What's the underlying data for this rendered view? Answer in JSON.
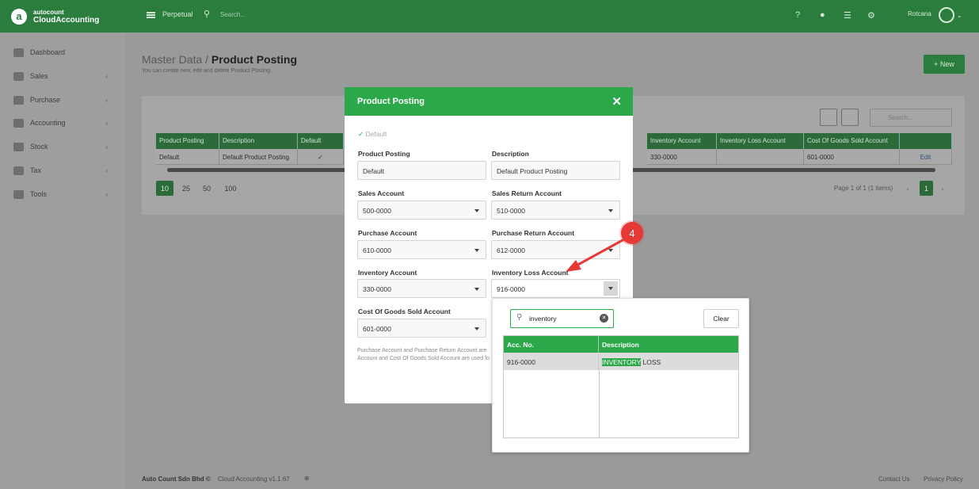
{
  "app": {
    "brand_top": "autocount",
    "brand_bottom": "CloudAccounting"
  },
  "topbar": {
    "mode": "Perpetual",
    "search_placeholder": "Search...",
    "user": "Rotcana"
  },
  "sidebar": {
    "items": [
      {
        "label": "Dashboard",
        "icon": "dashboard-icon"
      },
      {
        "label": "Sales",
        "icon": "sales-icon"
      },
      {
        "label": "Purchase",
        "icon": "purchase-icon"
      },
      {
        "label": "Accounting",
        "icon": "accounting-icon"
      },
      {
        "label": "Stock",
        "icon": "stock-icon"
      },
      {
        "label": "Tax",
        "icon": "tax-icon"
      },
      {
        "label": "Tools",
        "icon": "tools-icon"
      }
    ]
  },
  "page": {
    "crumb": "Master Data /",
    "title": "Product Posting",
    "subtitle": "You can create new, edit and delete Product Posting.",
    "new_button": "+ New",
    "search_placeholder": "Search..."
  },
  "table": {
    "headers": [
      "Product Posting",
      "Description",
      "Default",
      "Inventory Account",
      "Inventory Loss Account",
      "Cost Of Goods Sold Account",
      ""
    ],
    "row": [
      "Default",
      "Default Product Posting",
      "✓",
      "330-0000",
      "",
      "601-0000",
      "Edit"
    ]
  },
  "pagination": {
    "sizes": [
      "10",
      "25",
      "50",
      "100"
    ],
    "info": "Page 1 of 1 (1 items)",
    "page": "1"
  },
  "modal": {
    "title": "Product Posting",
    "default_label": "Default",
    "fields": {
      "product_posting": {
        "label": "Product Posting",
        "value": "Default"
      },
      "description": {
        "label": "Description",
        "value": "Default Product Posting"
      },
      "sales_account": {
        "label": "Sales Account",
        "value": "500-0000"
      },
      "sales_return_account": {
        "label": "Sales Return Account",
        "value": "510-0000"
      },
      "purchase_account": {
        "label": "Purchase Account",
        "value": "610-0000"
      },
      "purchase_return_account": {
        "label": "Purchase Return Account",
        "value": "612-0000"
      },
      "inventory_account": {
        "label": "Inventory Account",
        "value": "330-0000"
      },
      "inventory_loss_account": {
        "label": "Inventory Loss Account",
        "value": "916-0000"
      },
      "cogs_account": {
        "label": "Cost Of Goods Sold Account",
        "value": "601-0000"
      }
    },
    "note": "Purchase Account and Purchase Return Account are Account and Cost Of Goods Sold Account are used fo"
  },
  "dropdown": {
    "search_value": "inventory",
    "clear_label": "Clear",
    "headers": [
      "Acc. No.",
      "Description"
    ],
    "row": {
      "acc_no": "916-0000",
      "desc_highlight": "INVENTORY",
      "desc_rest": " LOSS"
    }
  },
  "callout": {
    "number": "4"
  },
  "footer": {
    "company": "Auto Count Sdn Bhd ©",
    "version": "Cloud Accounting v1.1.67",
    "contact": "Contact Us",
    "privacy": "Privacy Policy"
  }
}
